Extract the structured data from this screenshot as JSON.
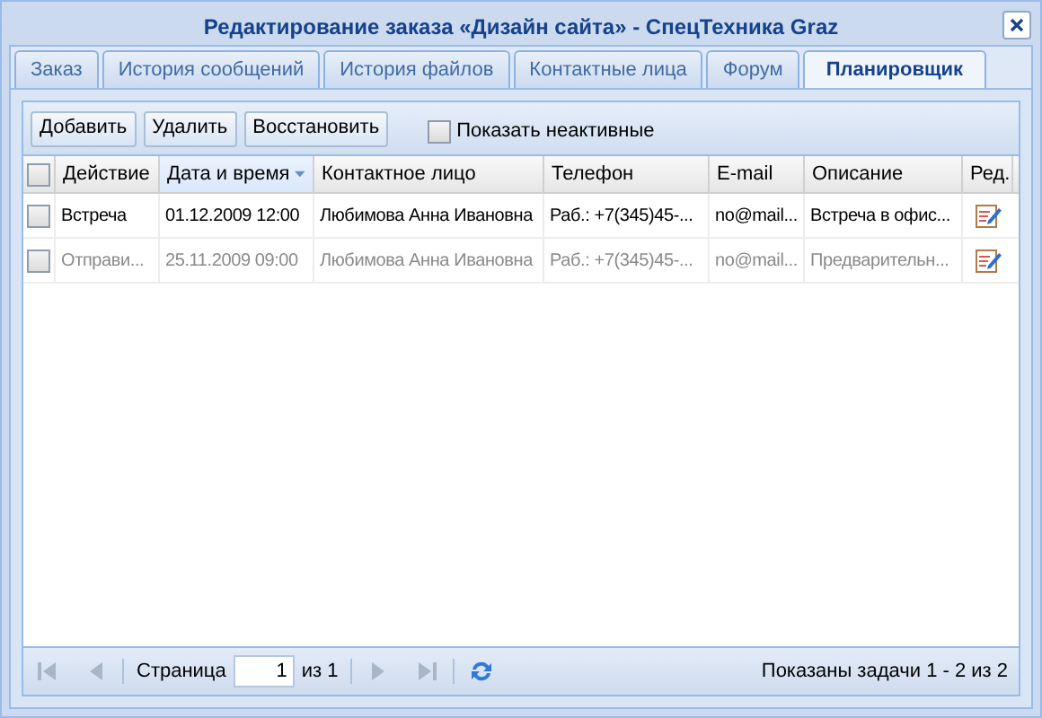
{
  "window": {
    "title": "Редактирование заказа «Дизайн сайта» - СпецТехника Graz"
  },
  "tabs": [
    {
      "label": "Заказ",
      "selected": false
    },
    {
      "label": "История сообщений",
      "selected": false
    },
    {
      "label": "История файлов",
      "selected": false
    },
    {
      "label": "Контактные лица",
      "selected": false
    },
    {
      "label": "Форум",
      "selected": false
    },
    {
      "label": "Планировщик",
      "selected": true
    }
  ],
  "toolbar": {
    "buttons": [
      "Добавить",
      "Удалить",
      "Восстановить"
    ],
    "show_inactive": {
      "label": "Показать неактивные",
      "checked": false
    }
  },
  "table": {
    "select_all": {
      "checked": false
    },
    "columns": [
      {
        "label": "Действие",
        "sorted": false
      },
      {
        "label": "Дата и время",
        "sorted": true
      },
      {
        "label": "Контактное лицо",
        "sorted": false
      },
      {
        "label": "Телефон",
        "sorted": false
      },
      {
        "label": "E-mail",
        "sorted": false
      },
      {
        "label": "Описание",
        "sorted": false
      },
      {
        "label": "Ред.",
        "sorted": false
      }
    ],
    "rows": [
      {
        "checked": false,
        "inactive": false,
        "cells": [
          "Встреча",
          "01.12.2009 12:00",
          "Любимова Анна Ивановна",
          "Раб.: +7(345)45-...",
          "no@mail...",
          "Встреча в офис..."
        ]
      },
      {
        "checked": false,
        "inactive": true,
        "cells": [
          "Отправи...",
          "25.11.2009 09:00",
          "Любимова Анна Ивановна",
          "Раб.: +7(345)45-...",
          "no@mail...",
          "Предварительн..."
        ]
      }
    ]
  },
  "pager": {
    "page_label": "Страница",
    "page": "1",
    "of": "из 1",
    "nav_disabled": true,
    "summary": "Показаны задачи 1 - 2 из 2"
  }
}
